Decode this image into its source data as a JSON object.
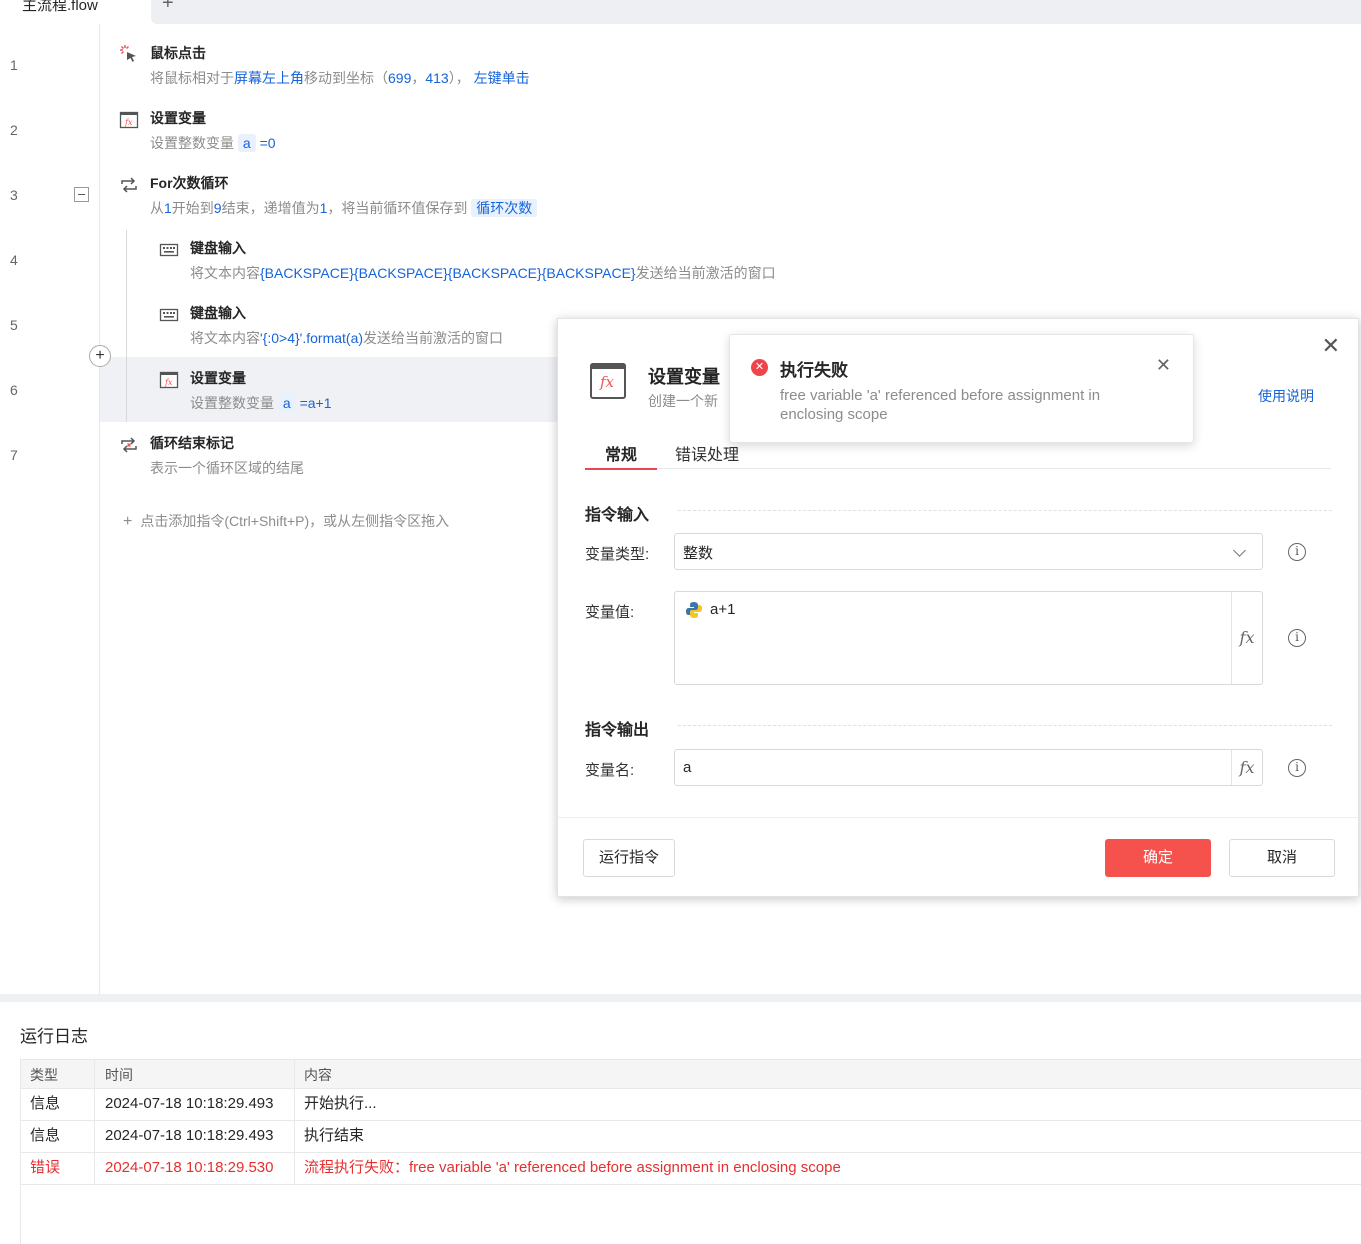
{
  "tabbar": {
    "file_tab": "主流程.flow",
    "add_label": "+"
  },
  "line_numbers": [
    "1",
    "2",
    "3",
    "4",
    "5",
    "6",
    "7"
  ],
  "steps": [
    {
      "title": "鼠标点击",
      "desc": [
        "将鼠标相对于",
        "屏幕左上角",
        "移动到坐标（",
        "699",
        "，",
        "413",
        "）， ",
        "左键单击"
      ]
    },
    {
      "title": "设置变量",
      "desc": [
        "设置整数变量 ",
        "a",
        " =",
        "0"
      ]
    },
    {
      "title": "For次数循环",
      "desc": [
        "从",
        "1",
        "开始到",
        "9",
        "结束，递增值为",
        "1",
        "，将当前循环值保存到 ",
        "循环次数"
      ]
    },
    {
      "title": "键盘输入",
      "desc": [
        "将文本内容",
        "{BACKSPACE}{BACKSPACE}{BACKSPACE}{BACKSPACE}",
        "发送给当前激活的窗口"
      ]
    },
    {
      "title": "键盘输入",
      "desc": [
        "将文本内容",
        "'{:0>4}'.format(a)",
        "发送给当前激活的窗口"
      ]
    },
    {
      "title": "设置变量",
      "desc": [
        "设置整数变量 ",
        "a",
        " =",
        "a+1"
      ]
    },
    {
      "title": "循环结束标记",
      "desc": [
        "表示一个循环区域的结尾"
      ]
    }
  ],
  "add_command_hint": "点击添加指令(Ctrl+Shift+P)，或从左侧指令区拖入",
  "dialog": {
    "title": "设置变量",
    "subtitle": "创建一个新",
    "help_link": "使用说明",
    "tabs": [
      "常规",
      "错误处理"
    ],
    "input_section": "指令输入",
    "output_section": "指令输出",
    "var_type_label": "变量类型:",
    "var_type_value": "整数",
    "var_value_label": "变量值:",
    "var_value": "a+1",
    "var_name_label": "变量名:",
    "var_name": "a",
    "fx_label": "fx",
    "run_button": "运行指令",
    "ok_button": "确定",
    "cancel_button": "取消"
  },
  "toast": {
    "title": "执行失败",
    "message": "free variable 'a' referenced before assignment in enclosing scope"
  },
  "log": {
    "title": "运行日志",
    "columns": [
      "类型",
      "时间",
      "内容"
    ],
    "rows": [
      {
        "type": "信息",
        "time": "2024-07-18 10:18:29.493",
        "content": "开始执行..."
      },
      {
        "type": "信息",
        "time": "2024-07-18 10:18:29.493",
        "content": "执行结束"
      },
      {
        "type": "错误",
        "time": "2024-07-18 10:18:29.530",
        "content": "流程执行失败：free variable 'a' referenced before assignment in enclosing scope"
      }
    ]
  },
  "colors": {
    "accent_blue": "#1664d9",
    "danger_red": "#f5524e",
    "error_text": "#e5302f"
  }
}
